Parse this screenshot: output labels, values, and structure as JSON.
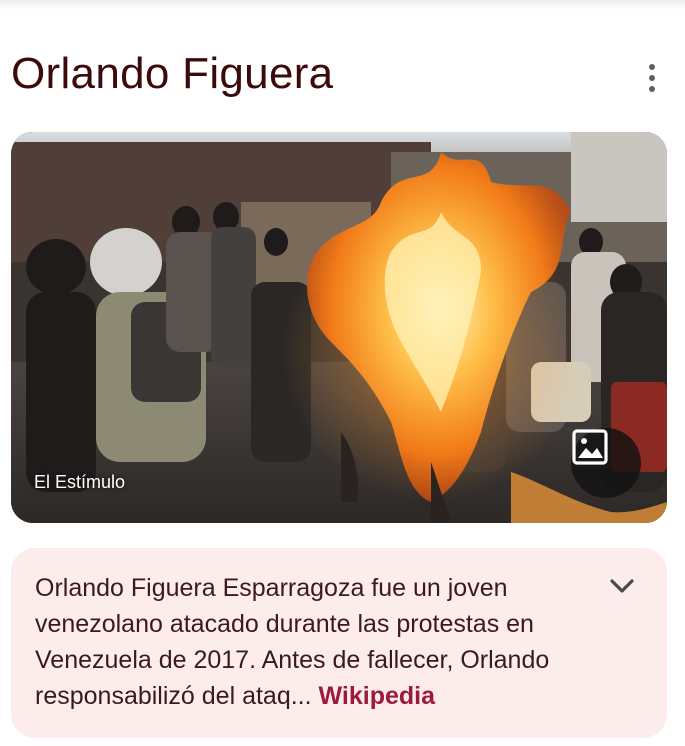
{
  "entity": {
    "title": "Orlando Figuera",
    "menu_icon": "more-vert-icon"
  },
  "image": {
    "credit": "El Estímulo",
    "alt": "Orlando Figuera",
    "view_images_icon": "image-icon"
  },
  "description": {
    "text": "Orlando Figuera Esparragoza fue un joven venezolano atacado durante las protestas en Venezuela de 2017. Antes de fallecer, Orlando responsabilizó del ataq",
    "ellipsis": "...",
    "source_label": "Wikipedia",
    "expand_icon": "chevron-down-icon"
  },
  "colors": {
    "title": "#3c0a0a",
    "card_bg": "#fdecec",
    "link": "#9a1b3d"
  }
}
